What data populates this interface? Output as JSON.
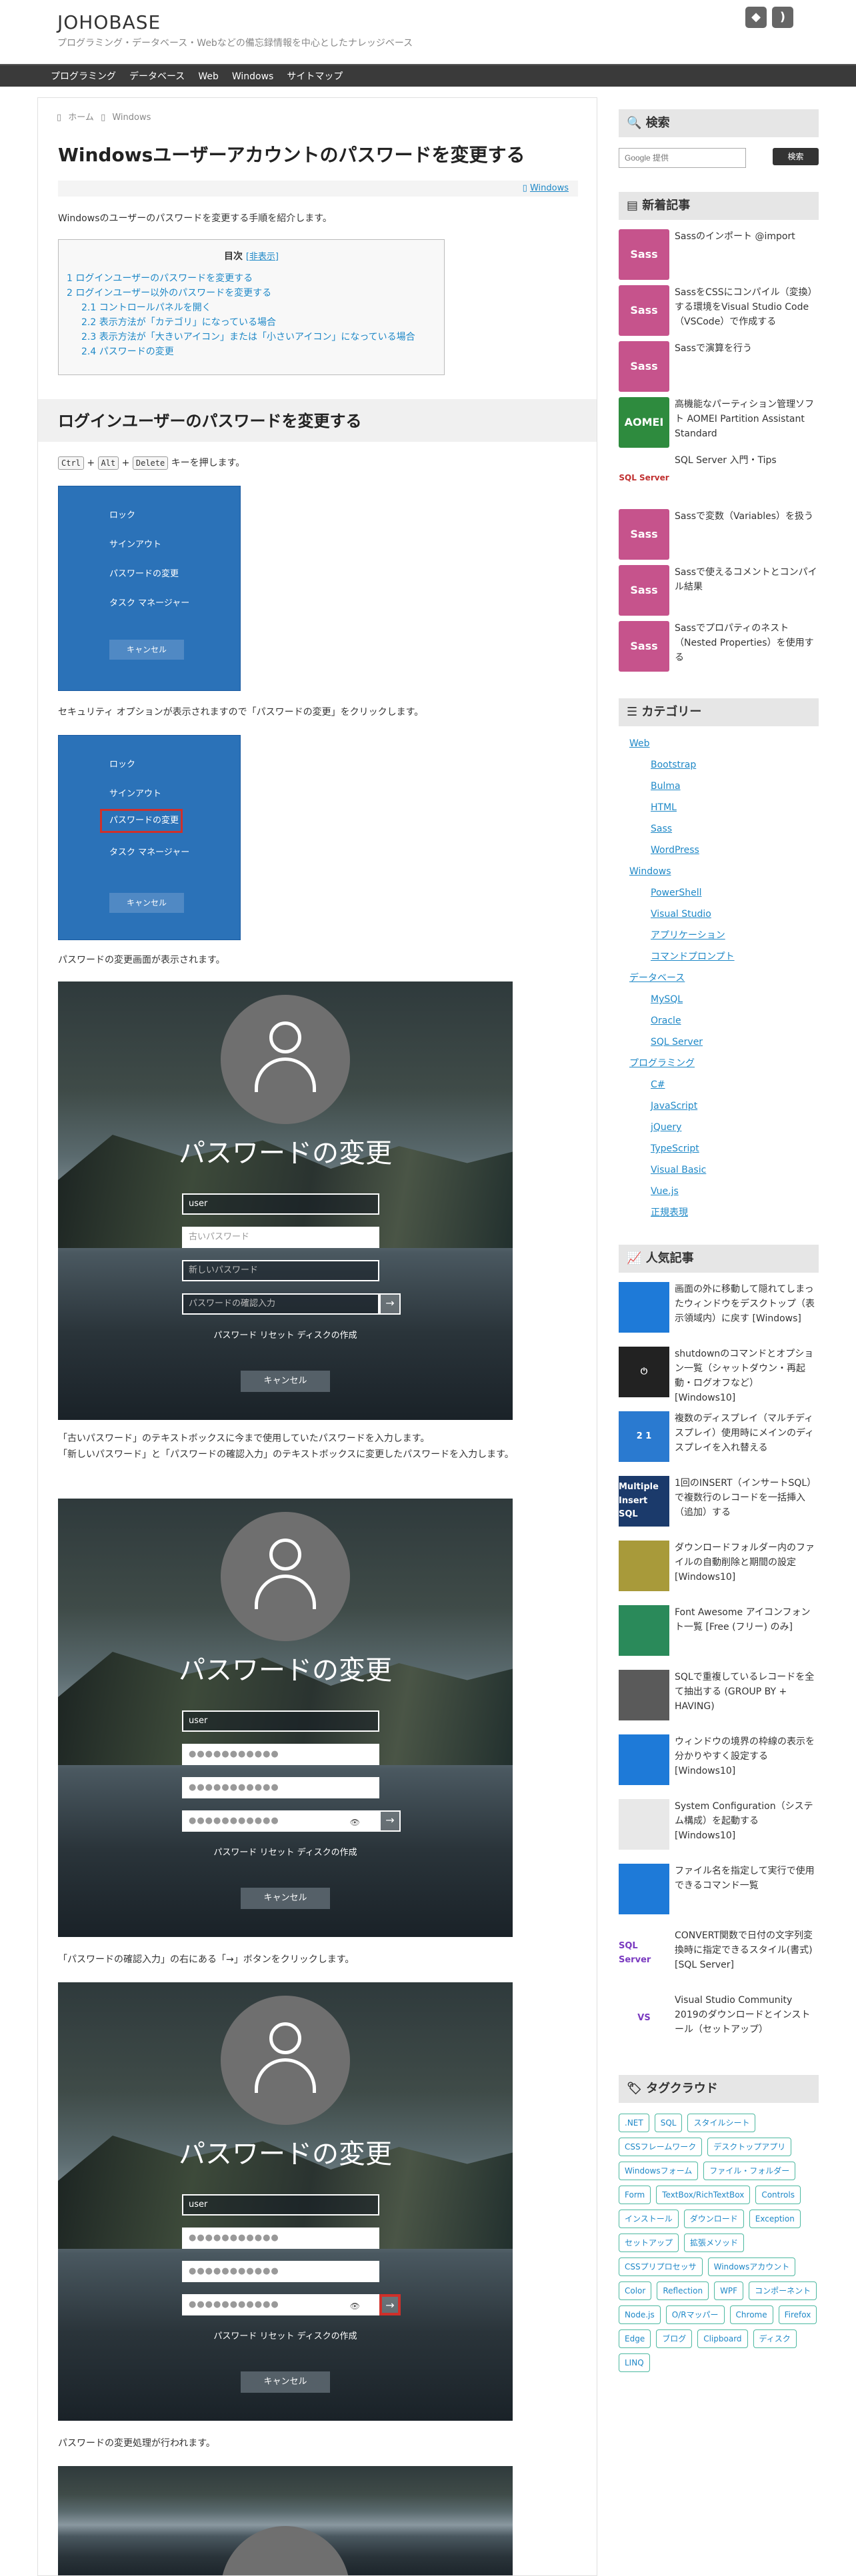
{
  "site": {
    "title": "JOHOBASE",
    "description": "プログラミング・データベース・Webなどの備忘録情報を中心としたナレッジベース"
  },
  "nav": [
    "プログラミング",
    "データベース",
    "Web",
    "Windows",
    "サイトマップ"
  ],
  "breadcrumb": {
    "home": "ホーム",
    "category": "Windows"
  },
  "article": {
    "title": "Windowsユーザーアカウントのパスワードを変更する",
    "category": "Windows",
    "intro": "Windowsのユーザーのパスワードを変更する手順を紹介します。",
    "toc": {
      "title": "目次",
      "toggle": "[非表示]",
      "items": [
        {
          "label": "1 ログインユーザーのパスワードを変更する",
          "sub": false
        },
        {
          "label": "2 ログインユーザー以外のパスワードを変更する",
          "sub": false
        },
        {
          "label": "2.1 コントロールパネルを開く",
          "sub": true
        },
        {
          "label": "2.2 表示方法が「カテゴリ」になっている場合",
          "sub": true
        },
        {
          "label": "2.3 表示方法が「大きいアイコン」または「小さいアイコン」になっている場合",
          "sub": true
        },
        {
          "label": "2.4 パスワードの変更",
          "sub": true
        }
      ]
    },
    "section1": "ログインユーザーのパスワードを変更する",
    "keys": [
      "Ctrl",
      "Alt",
      "Delete"
    ],
    "keys_text": "キーを押します。",
    "p_security": "セキュリティ オプションが表示されますので「パスワードの変更」をクリックします。",
    "p_change_screen": "パスワードの変更画面が表示されます。",
    "p_old": "「古いパスワード」のテキストボックスに今まで使用していたパスワードを入力します。",
    "p_new": "「新しいパスワード」と「パスワードの確認入力」のテキストボックスに変更したパスワードを入力します。",
    "p_arrow": "「パスワードの確認入力」の右にある「→」ボタンをクリックします。",
    "p_process": "パスワードの変更処理が行われます。"
  },
  "security_menu": {
    "items": [
      "ロック",
      "サインアウト",
      "パスワードの変更",
      "タスク マネージャー"
    ],
    "cancel": "キャンセル"
  },
  "pw_screen": {
    "heading": "パスワードの変更",
    "user": "user",
    "old_placeholder": "古いパスワード",
    "new_placeholder": "新しいパスワード",
    "confirm_placeholder": "パスワードの確認入力",
    "masked": "●●●●●●●●●●●",
    "reset_disk": "パスワード リセット ディスクの作成",
    "cancel": "キャンセル",
    "arrow": "→",
    "eye": "👁"
  },
  "sidebar": {
    "search_title": "検索",
    "search_placeholder": "Google 提供",
    "search_button": "検索",
    "recent_title": "新着記事",
    "recent": [
      {
        "title": "Sassのインポート @import",
        "thumb": "Sass",
        "color": "#c6538c"
      },
      {
        "title": "SassをCSSにコンパイル（変換）する環境をVisual Studio Code（VSCode）で作成する",
        "thumb": "Sass",
        "color": "#c6538c"
      },
      {
        "title": "Sassで演算を行う",
        "thumb": "Sass",
        "color": "#c6538c"
      },
      {
        "title": "高機能なパーティション管理ソフト AOMEI Partition Assistant Standard",
        "thumb": "AOMEI",
        "color": "#2e8b3e"
      },
      {
        "title": "SQL Server 入門・Tips",
        "thumb": "SQL Server",
        "color": "#ffffff"
      },
      {
        "title": "Sassで変数（Variables）を扱う",
        "thumb": "Sass",
        "color": "#c6538c"
      },
      {
        "title": "Sassで使えるコメントとコンパイル結果",
        "thumb": "Sass",
        "color": "#c6538c"
      },
      {
        "title": "Sassでプロパティのネスト（Nested Properties）を使用する",
        "thumb": "Sass",
        "color": "#c6538c"
      }
    ],
    "category_title": "カテゴリー",
    "categories": [
      {
        "label": "Web",
        "lvl": 1
      },
      {
        "label": "Bootstrap",
        "lvl": 2
      },
      {
        "label": "Bulma",
        "lvl": 2
      },
      {
        "label": "HTML",
        "lvl": 2
      },
      {
        "label": "Sass",
        "lvl": 2
      },
      {
        "label": "WordPress",
        "lvl": 2
      },
      {
        "label": "Windows",
        "lvl": 1
      },
      {
        "label": "PowerShell",
        "lvl": 2
      },
      {
        "label": "Visual Studio",
        "lvl": 2
      },
      {
        "label": "アプリケーション",
        "lvl": 2
      },
      {
        "label": "コマンドプロンプト",
        "lvl": 2
      },
      {
        "label": "データベース",
        "lvl": 1
      },
      {
        "label": "MySQL",
        "lvl": 2
      },
      {
        "label": "Oracle",
        "lvl": 2
      },
      {
        "label": "SQL Server",
        "lvl": 2
      },
      {
        "label": "プログラミング",
        "lvl": 1
      },
      {
        "label": "C#",
        "lvl": 2
      },
      {
        "label": "JavaScript",
        "lvl": 2
      },
      {
        "label": "jQuery",
        "lvl": 2
      },
      {
        "label": "TypeScript",
        "lvl": 2
      },
      {
        "label": "Visual Basic",
        "lvl": 2
      },
      {
        "label": "Vue.js",
        "lvl": 2
      },
      {
        "label": "正規表現",
        "lvl": 2
      }
    ],
    "popular_title": "人気記事",
    "popular": [
      {
        "title": "画面の外に移動して隠れてしまったウィンドウをデスクトップ（表示領域内）に戻す [Windows]",
        "thumb": "",
        "color": "#1e7ad8"
      },
      {
        "title": "shutdownのコマンドとオプション一覧（シャットダウン・再起動・ログオフなど）[Windows10]",
        "thumb": "⏻",
        "color": "#222222"
      },
      {
        "title": "複数のディスプレイ（マルチディスプレイ）使用時にメインのディスプレイを入れ替える",
        "thumb": "2 1",
        "color": "#2a7ad0"
      },
      {
        "title": "1回のINSERT（インサートSQL）で複数行のレコードを一括挿入（追加）する",
        "thumb": "Multiple Insert SQL",
        "color": "#1b3a6b"
      },
      {
        "title": "ダウンロードフォルダー内のファイルの自動削除と期間の設定 [Windows10]",
        "thumb": "",
        "color": "#a89a3a"
      },
      {
        "title": "Font Awesome アイコンフォント一覧 [Free (フリー) のみ]",
        "thumb": "",
        "color": "#2a8a5a"
      },
      {
        "title": "SQLで重複しているレコードを全て抽出する (GROUP BY + HAVING)",
        "thumb": "",
        "color": "#5a5a5a"
      },
      {
        "title": "ウィンドウの境界の枠線の表示を分かりやすく設定する [Windows10]",
        "thumb": "",
        "color": "#1e7ad8"
      },
      {
        "title": "System Configuration（システム構成）を起動する [Windows10]",
        "thumb": "",
        "color": "#e8e8e8"
      },
      {
        "title": "ファイル名を指定して実行で使用できるコマンド一覧",
        "thumb": "",
        "color": "#1e7ad8"
      },
      {
        "title": "CONVERT関数で日付の文字列変換時に指定できるスタイル(書式) [SQL Server]",
        "thumb": "SQL Server",
        "color": "#ffffff"
      },
      {
        "title": "Visual Studio Community 2019のダウンロードとインストール（セットアップ）",
        "thumb": "VS",
        "color": "#ffffff"
      }
    ],
    "tags_title": "タグクラウド",
    "tags": [
      ".NET",
      "SQL",
      "スタイルシート",
      "CSSフレームワーク",
      "デスクトップアプリ",
      "Windowsフォーム",
      "ファイル・フォルダー",
      "Form",
      "TextBox/RichTextBox",
      "Controls",
      "インストール",
      "ダウンロード",
      "Exception",
      "セットアップ",
      "拡張メソッド",
      "CSSプリプロセッサ",
      "Windowsアカウント",
      "Color",
      "Reflection",
      "WPF",
      "コンポーネント",
      "Node.js",
      "O/Rマッパー",
      "Chrome",
      "Firefox",
      "Edge",
      "ブログ",
      "Clipboard",
      "ディスク",
      "LINQ"
    ]
  }
}
